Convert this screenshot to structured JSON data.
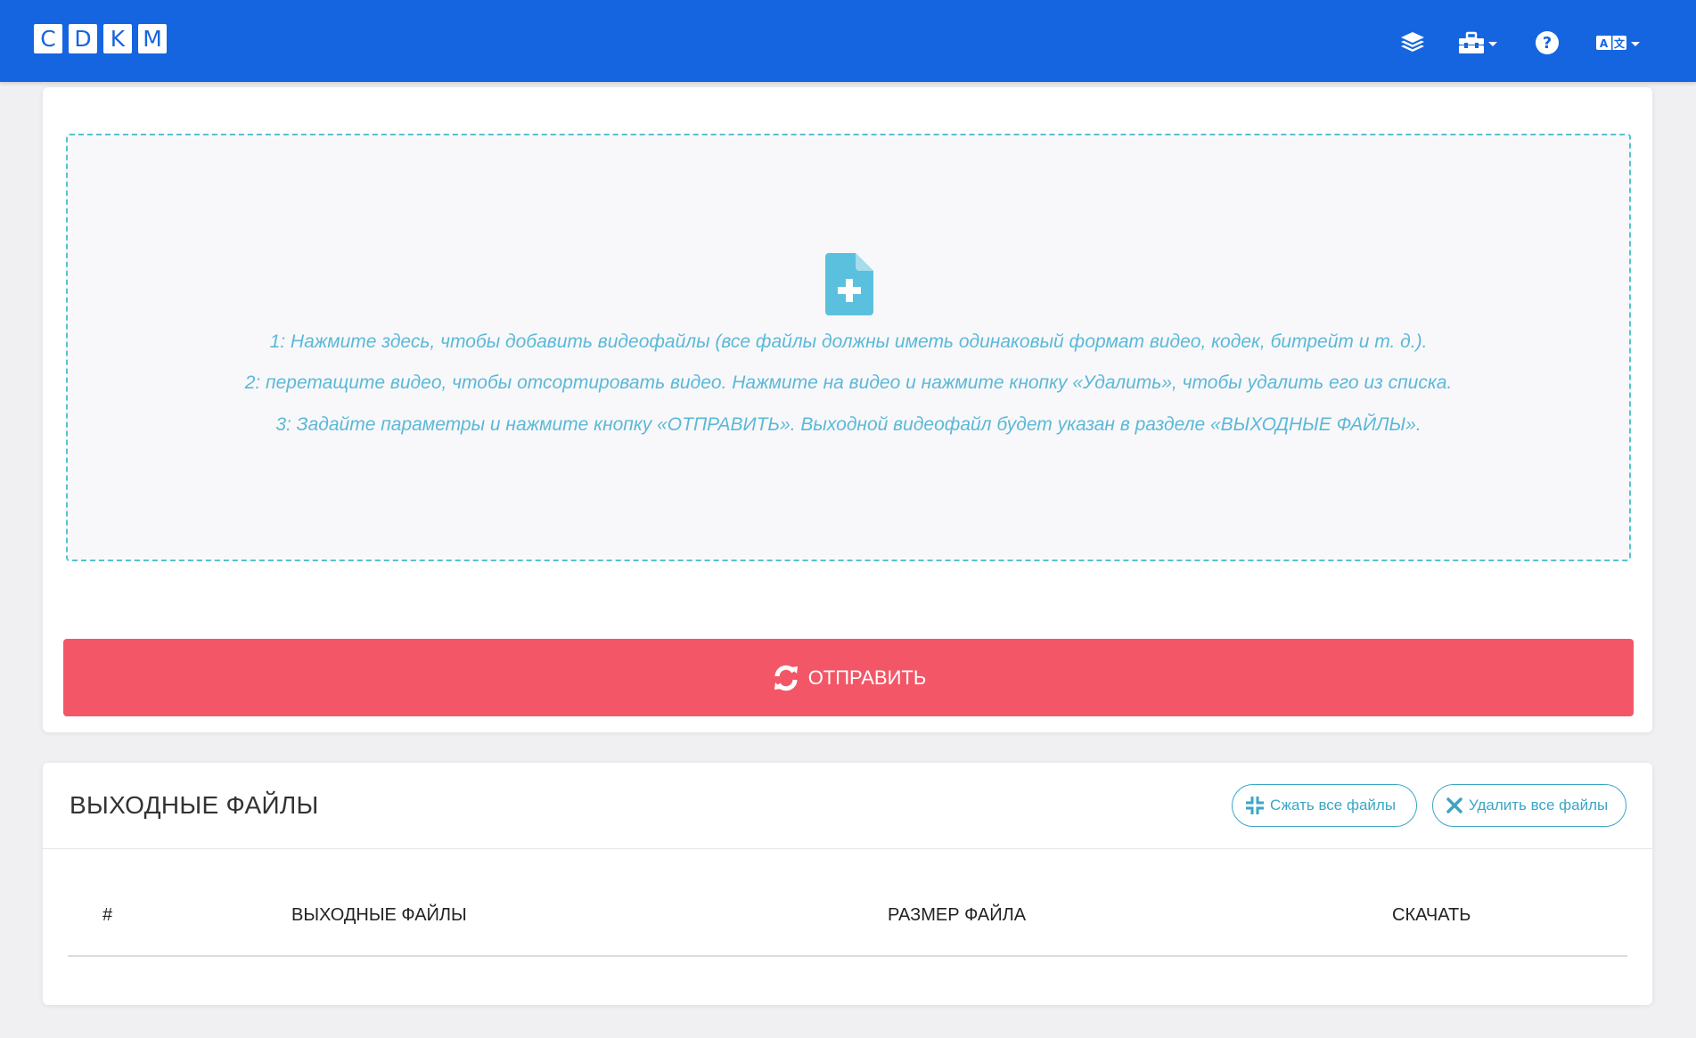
{
  "header": {
    "logo_letters": [
      "C",
      "D",
      "K",
      "M"
    ],
    "icons": [
      "layers-icon",
      "toolbox-icon",
      "help-icon",
      "language-icon"
    ],
    "brand_color": "#1565e0"
  },
  "upload": {
    "icon": "file-plus-icon",
    "instructions": [
      "1: Нажмите здесь, чтобы добавить видеофайлы (все файлы должны иметь одинаковый формат видео, кодек, битрейт и т. д.).",
      "2: перетащите видео, чтобы отсортировать видео. Нажмите на видео и нажмите кнопку «Удалить», чтобы удалить его из списка.",
      "3: Задайте параметры и нажмите кнопку «ОТПРАВИТЬ». Выходной видеофайл будет указан в разделе «ВЫХОДНЫЕ ФАЙЛЫ»."
    ],
    "submit_label": "ОТПРАВИТЬ",
    "submit_color": "#f35767"
  },
  "output": {
    "title": "ВЫХОДНЫЕ ФАЙЛЫ",
    "compress_all_label": "Сжать все файлы",
    "delete_all_label": "Удалить все файлы",
    "table": {
      "columns": [
        "#",
        "ВЫХОДНЫЕ ФАЙЛЫ",
        "РАЗМЕР ФАЙЛА",
        "СКАЧАТЬ"
      ],
      "rows": []
    }
  }
}
